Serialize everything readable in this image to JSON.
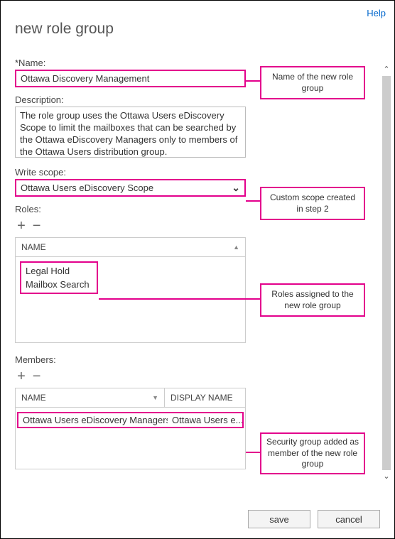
{
  "help_label": "Help",
  "page_title": "new role group",
  "fields": {
    "name": {
      "label": "*Name:",
      "value": "Ottawa Discovery Management"
    },
    "description": {
      "label": "Description:",
      "value": "The role group uses the Ottawa Users eDiscovery Scope to limit the mailboxes that can be searched by the Ottawa eDiscovery Managers only to members of the Ottawa Users distribution group."
    },
    "write_scope": {
      "label": "Write scope:",
      "value": "Ottawa Users eDiscovery Scope"
    }
  },
  "roles": {
    "label": "Roles:",
    "header": "NAME",
    "items": [
      "Legal Hold",
      "Mailbox Search"
    ]
  },
  "members": {
    "label": "Members:",
    "headers": {
      "name": "NAME",
      "display": "DISPLAY NAME"
    },
    "rows": [
      {
        "name": "Ottawa Users eDiscovery Managers",
        "display": "Ottawa Users e..."
      }
    ]
  },
  "buttons": {
    "save": "save",
    "cancel": "cancel"
  },
  "callouts": {
    "name": "Name of the new role group",
    "scope": "Custom scope created in step 2",
    "roles": "Roles assigned to the new role group",
    "members": "Security group added as member of the new role group"
  },
  "colors": {
    "accent": "#e3008c",
    "link": "#0066cc"
  }
}
